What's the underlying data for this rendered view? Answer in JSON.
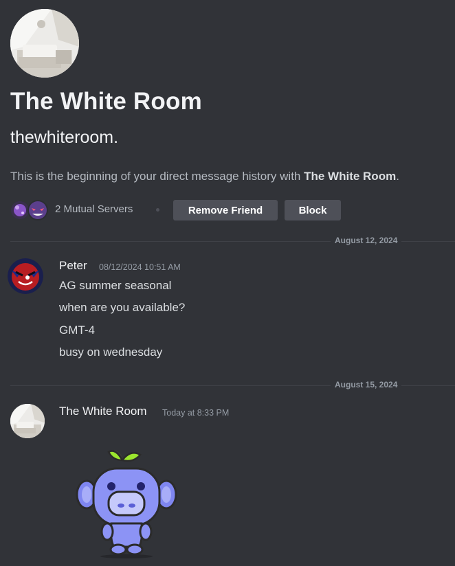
{
  "profile": {
    "display_name": "The White Room",
    "username": "thewhiteroom.",
    "intro_prefix": "This is the beginning of your direct message history with ",
    "intro_name": "The White Room",
    "intro_suffix": ".",
    "mutual_servers": "2 Mutual Servers",
    "remove_friend_label": "Remove Friend",
    "block_label": "Block"
  },
  "messages": [
    {
      "date_divider": "August 12, 2024",
      "author": "Peter",
      "timestamp": "08/12/2024 10:51 AM",
      "lines": [
        "AG summer seasonal",
        "when are you available?",
        "GMT-4",
        "busy on wednesday"
      ]
    },
    {
      "date_divider": "August 15, 2024",
      "author": "The White Room",
      "timestamp": "Today at 8:33 PM",
      "sticker": "wumpus-sticker"
    }
  ],
  "colors": {
    "background": "#313338",
    "button": "#4e5058",
    "muted_text": "#949ba4",
    "text": "#dbdee1"
  }
}
